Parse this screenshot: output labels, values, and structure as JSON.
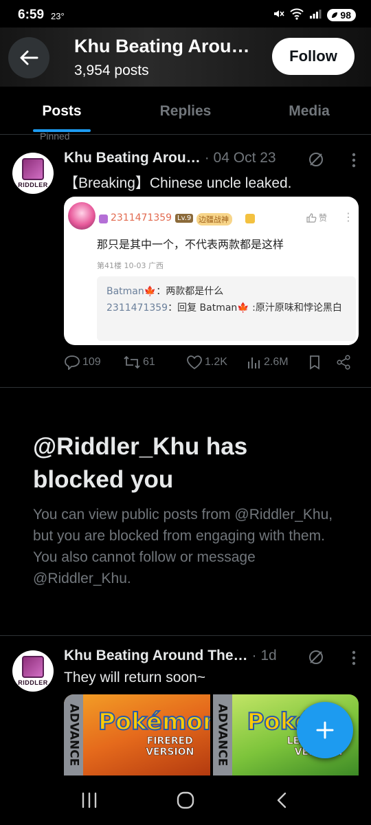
{
  "status": {
    "time": "6:59",
    "temp": "23°",
    "battery": "98"
  },
  "header": {
    "title": "Khu Beating Arou…",
    "post_count": "3,954 posts",
    "follow_label": "Follow"
  },
  "tabs": [
    {
      "label": "Posts",
      "active": true
    },
    {
      "label": "Replies",
      "active": false
    },
    {
      "label": "Media",
      "active": false
    }
  ],
  "pinned_label": "Pinned",
  "tweet1": {
    "name": "Khu Beating Arou…",
    "meta": "· 04 Oct 23",
    "text": "【Breaking】Chinese uncle leaked.",
    "avatar_text": "RIDDLER",
    "card": {
      "user": "2311471359",
      "level": "Lv.9",
      "rank": "边疆战神",
      "like": "赞",
      "body": "那只是其中一个，不代表两款都是这样",
      "info": "第41楼  10-03  广西",
      "quote_line1_name": "Batman🍁",
      "quote_line1_text": "：两款都是什么",
      "quote_line2_name": "2311471359",
      "quote_line2_text": "：回复 Batman🍁 :原汁原味和悖论黑白"
    },
    "actions": {
      "replies": "109",
      "retweets": "61",
      "likes": "1.2K",
      "views": "2.6M"
    }
  },
  "blocked": {
    "title": "@Riddler_Khu has blocked you",
    "body": "You can view public posts from @Riddler_Khu, but you are blocked from engaging with them. You also cannot follow or message @Riddler_Khu."
  },
  "tweet2": {
    "name": "Khu Beating Around The…",
    "meta": "· 1d",
    "text": "They will return soon~",
    "avatar_text": "RIDDLER",
    "games": [
      {
        "strip": "ADVANCE",
        "logo": "Pokémon",
        "version": "FIRERED VERSION"
      },
      {
        "strip": "ADVANCE",
        "logo": "Poké",
        "version": "LEAFGREEN VERSION"
      }
    ]
  },
  "colors": {
    "accent": "#1d9bf0",
    "background": "#000000",
    "muted": "#71767b"
  }
}
